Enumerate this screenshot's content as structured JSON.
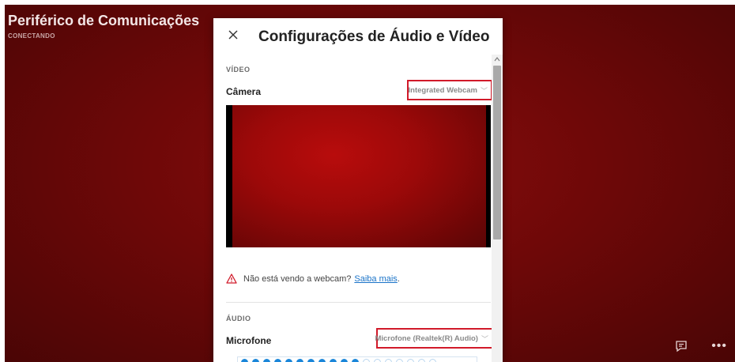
{
  "call": {
    "title": "Periférico de Comunicações",
    "status": "CONECTANDO"
  },
  "dialog": {
    "title": "Configurações de Áudio e Vídeo",
    "video": {
      "section_label": "VÍDEO",
      "camera_label": "Câmera",
      "camera_selected": "Integrated Webcam",
      "warning_text": "Não está vendo a webcam?",
      "learn_more": "Saiba mais",
      "period": "."
    },
    "audio": {
      "section_label": "ÁUDIO",
      "mic_label": "Microfone",
      "mic_selected": "Microfone (Realtek(R) Audio)",
      "level_active": 11,
      "level_total": 18
    }
  },
  "icons": {
    "close": "close-icon",
    "warning": "warning-icon",
    "chevron": "chevron-down-icon",
    "chat": "chat-icon",
    "more": "more-icon"
  },
  "colors": {
    "highlight": "#d11a2a",
    "link": "#1a73c8",
    "meter_on": "#1a86d9"
  }
}
